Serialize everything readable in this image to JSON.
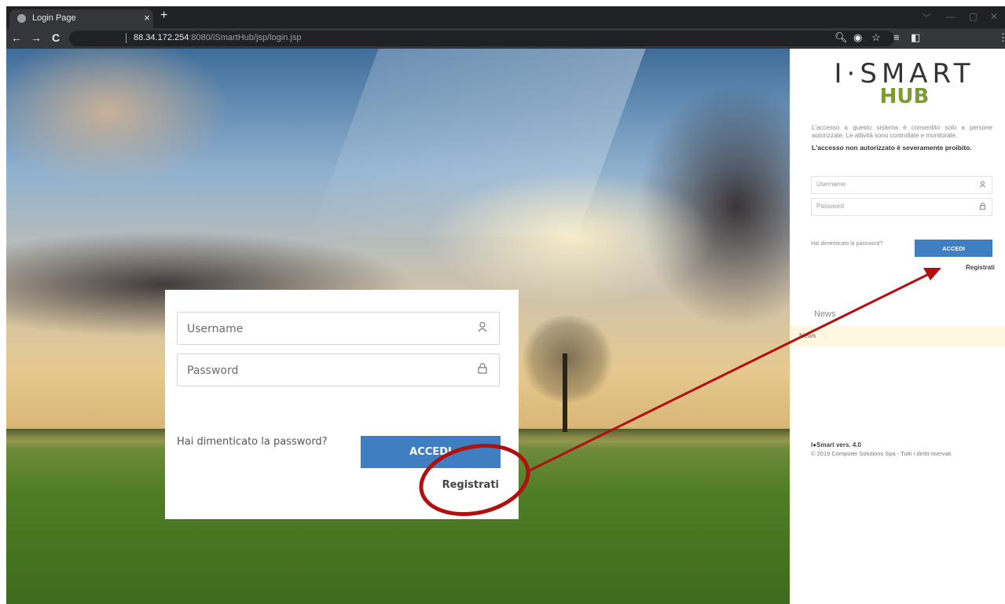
{
  "browser": {
    "tab_title": "Login Page",
    "tab_close": "×",
    "new_tab": "+",
    "url_host": "88.34.172.254",
    "url_rest": ":8080/iSmartHub/jsp/login.jsp",
    "back": "←",
    "forward": "→",
    "reload": "C",
    "menu": "⋮"
  },
  "zoom_card": {
    "username_placeholder": "Username",
    "password_placeholder": "Password",
    "forgot_label": "Hai dimenticato la password?",
    "submit_label": "ACCEDI",
    "register_label": "Registrati"
  },
  "panel": {
    "logo_top": "I·SMART",
    "logo_bottom": "HUB",
    "notice": "L'accesso a questo sistema è consentito solo a persone autorizzate. Le attività sono controllate e monitorate.",
    "notice_strong": "L'accesso non autorizzato è severamente proibito.",
    "username_placeholder": "Username",
    "password_placeholder": "Password",
    "forgot_label": "Hai dimenticato la password?",
    "submit_label": "ACCEDI",
    "register_label": "Registrati",
    "news_title": "News",
    "news_item": "News",
    "version": "I●Smart vers. 4.0",
    "copyright": "© 2019 Computer Solutions Spa - Tutti i diritti riservati"
  },
  "colors": {
    "accent_button": "#3f7fc1",
    "logo_green": "#7d9a33",
    "annotation_red": "#b01010"
  },
  "icons": [
    "user-icon",
    "lock-icon",
    "search-icon",
    "star-icon",
    "eye-icon",
    "sidepanel-icon",
    "reading-list-icon"
  ]
}
